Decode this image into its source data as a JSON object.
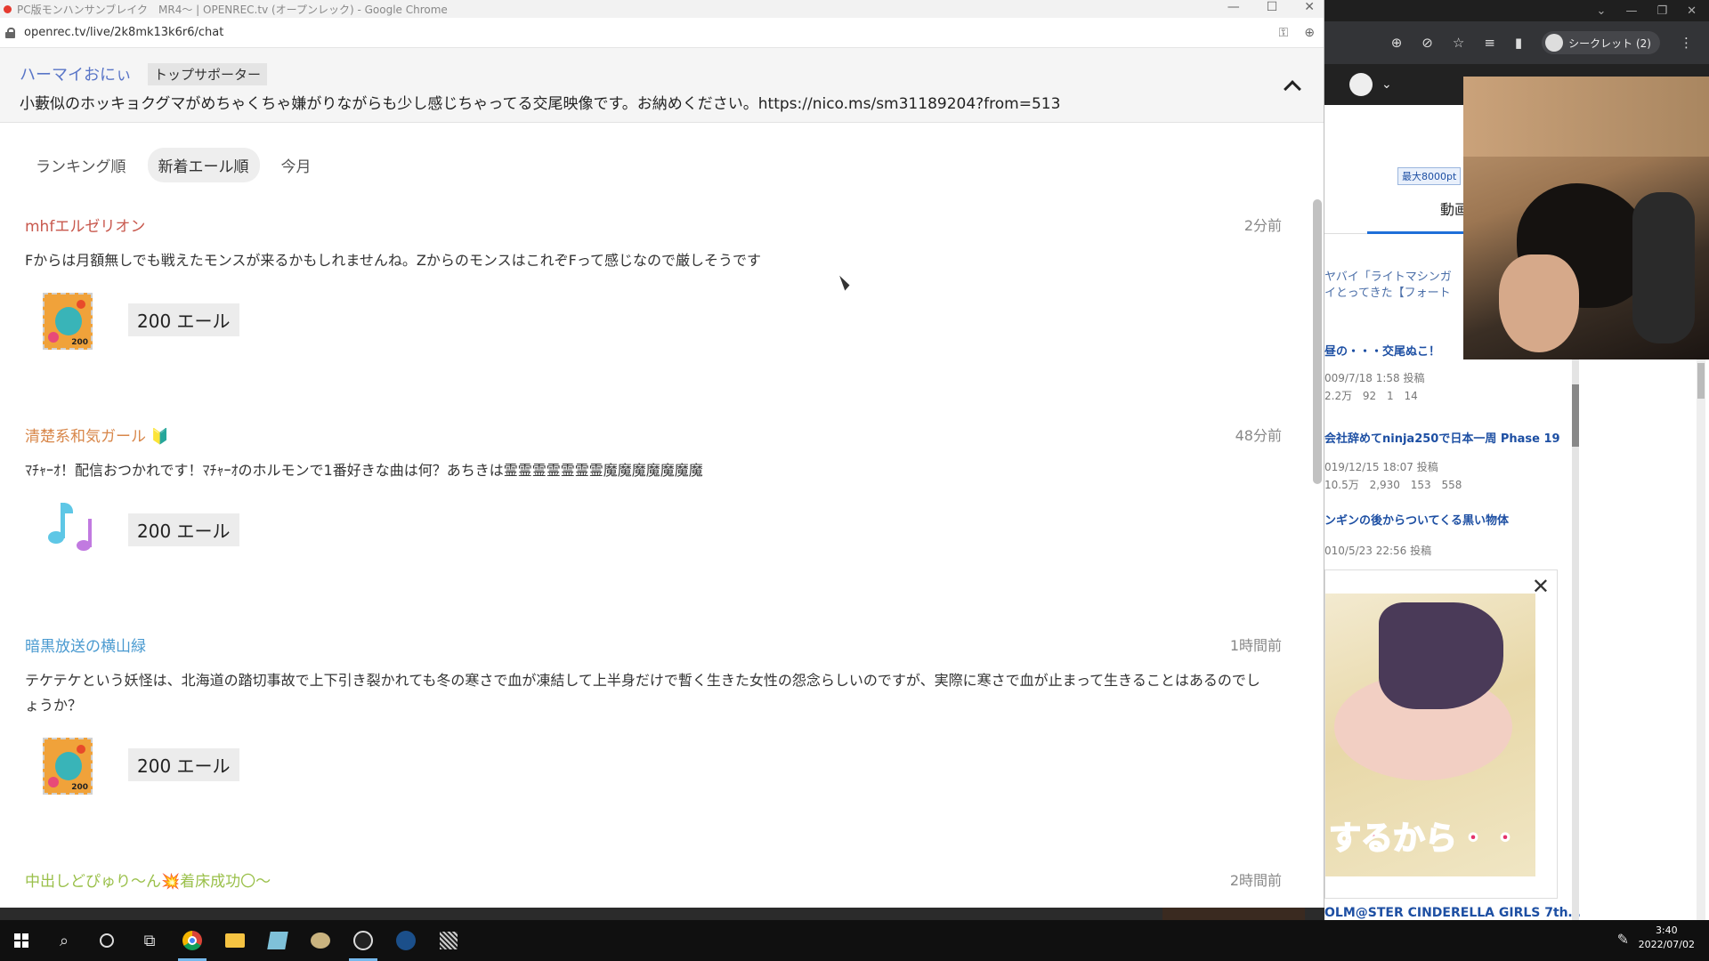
{
  "window": {
    "title": "PC版モンハンサンブレイク　MR4～ | OPENREC.tv (オープンレック) - Google Chrome",
    "url": "openrec.tv/live/2k8mk13k6r6/chat"
  },
  "pinned": {
    "name": "ハーマイおにぃ",
    "badge": "トップサポーター",
    "text": "小藪似のホッキョクグマがめちゃくちゃ嫌がりながらも少し感じちゃってる交尾映像です。お納めください。https://nico.ms/sm31189204?from=513"
  },
  "tabs": [
    {
      "label": "ランキング順",
      "active": false
    },
    {
      "label": "新着エール順",
      "active": true
    },
    {
      "label": "今月",
      "active": false
    }
  ],
  "yells": [
    {
      "name": "mhfエルゼリオン",
      "name_color": "#c8584d",
      "time": "2分前",
      "message": "Fからは月額無しでも戦えたモンスが来るかもしれませんね。ZからのモンスはこれぞFって感じなので厳しそうです",
      "icon": "stamp-200-icon",
      "amount": "200 エール"
    },
    {
      "name": "清楚系和気ガール 🔰",
      "name_color": "#d8874a",
      "time": "48分前",
      "message": "ﾏﾁｬｰｵ！配信おつかれです！ﾏﾁｬｰｵのホルモンで1番好きな曲は何？あちきは霊霊霊霊霊霊霊魔魔魔魔魔魔魔",
      "icon": "music-notes-icon",
      "amount": "200 エール"
    },
    {
      "name": "暗黒放送の横山緑",
      "name_color": "#4a9ad0",
      "time": "1時間前",
      "message": "テケテケという妖怪は、北海道の踏切事故で上下引き裂かれても冬の寒さで血が凍結して上半身だけで暫く生きた女性の怨念らしいのですが、実際に寒さで血が止まって生きることはあるのでしょうか？",
      "icon": "stamp-200-icon",
      "amount": "200 エール"
    },
    {
      "name": "中出しどぴゅり～ん💥着床成功〇～",
      "name_color": "#9ac04a",
      "time": "2時間前",
      "message": "",
      "icon": "",
      "amount": ""
    }
  ],
  "stamp_number": "200",
  "background_window": {
    "incognito_label": "シークレット (2)",
    "points_pill": "最大8000pt",
    "tab_label": "動画",
    "items": [
      {
        "title": "ヤバイ「ライトマシンガ",
        "sub": "イとってきた【フォート"
      },
      {
        "title": "昼の・・・交尾ぬこ！",
        "date": "009/7/18 1:58 投稿",
        "views": "2.2万",
        "comments": "92",
        "likes": "1",
        "mylists": "14"
      },
      {
        "title": "会社辞めてninja250で日本一周 Phase 19",
        "date": "019/12/15 18:07 投稿",
        "views": "10.5万",
        "comments": "2,930",
        "likes": "153",
        "mylists": "558"
      },
      {
        "title": "ンギンの後からついてくる黒い物体",
        "date": "010/5/23 22:56 投稿"
      }
    ],
    "bottom_text": "OLM@STER CINDERELLA GIRLS 7th…",
    "ad_text": "するから・・"
  },
  "taskbar": {
    "time": "3:40",
    "date": "2022/07/02"
  }
}
